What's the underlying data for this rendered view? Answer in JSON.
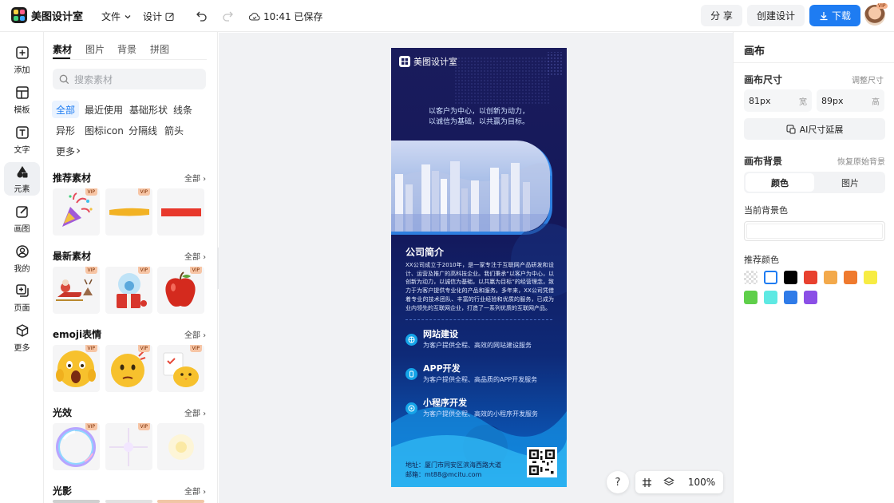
{
  "app": {
    "name": "美图设计室"
  },
  "topbar": {
    "file_menu": "文件",
    "design_menu": "设计",
    "save_status": "10:41 已保存",
    "share_label": "分 享",
    "create_label": "创建设计",
    "download_label": "下载",
    "avatar_badge": "VIP"
  },
  "leftnav": {
    "items": [
      {
        "label": "添加",
        "icon": "plus-square-icon"
      },
      {
        "label": "模板",
        "icon": "template-icon"
      },
      {
        "label": "文字",
        "icon": "text-icon"
      },
      {
        "label": "元素",
        "icon": "shapes-icon"
      },
      {
        "label": "画图",
        "icon": "draw-icon"
      },
      {
        "label": "我的",
        "icon": "user-icon"
      },
      {
        "label": "页面",
        "icon": "page-add-icon"
      },
      {
        "label": "更多",
        "icon": "cube-icon"
      }
    ],
    "active_index": 3
  },
  "panel": {
    "tabs": [
      "素材",
      "图片",
      "背景",
      "拼图"
    ],
    "active_tab": 0,
    "search_placeholder": "搜索素材",
    "chips": [
      "全部",
      "最近使用",
      "基础形状",
      "线条",
      "异形",
      "图标icon",
      "分隔线",
      "箭头",
      "更多"
    ],
    "active_chip": 0,
    "all_label": "全部",
    "vip_label": "VIP",
    "sections": [
      {
        "title": "推荐素材"
      },
      {
        "title": "最新素材"
      },
      {
        "title": "emoji表情"
      },
      {
        "title": "光效"
      },
      {
        "title": "光影"
      }
    ]
  },
  "poster": {
    "brand": "美图设计室",
    "slogan_line1": "以客户为中心，以创新为动力，",
    "slogan_line2": "以诚信为基础，以共赢为目标。",
    "intro_title": "公司简介",
    "intro_text": "XX公司成立于2010年，是一家专注于互联网产品研发和设计、运营及推广的高科技企业。我们秉承“以客户为中心，以创新为动力，以诚信为基础，以共赢为目标”的经营理念，致力于为客户提供专业化的产品和服务。多年来，XX公司凭借着专业的技术团队、丰富的行业经验和优质的服务，已成为业内领先的互联网企业，打造了一系列优质的互联网产品。",
    "services": [
      {
        "title": "网站建设",
        "desc": "为客户提供全程、高效的网站建设服务"
      },
      {
        "title": "APP开发",
        "desc": "为客户提供全程、高品质的APP开发服务"
      },
      {
        "title": "小程序开发",
        "desc": "为客户提供全程、高效的小程序开发服务"
      }
    ],
    "address": "地址：厦门市同安区滨海西路大道",
    "email": "邮箱：mt88@mcitu.com"
  },
  "right": {
    "canvas_title": "画布",
    "size_label": "画布尺寸",
    "adjust_label": "调整尺寸",
    "width_value": "81px",
    "width_unit": "宽",
    "height_value": "89px",
    "height_unit": "高",
    "ai_extend_label": "AI尺寸延展",
    "bg_label": "画布背景",
    "restore_label": "恢复原始背景",
    "bg_tabs": [
      "颜色",
      "图片"
    ],
    "current_bg_label": "当前背景色",
    "recommend_label": "推荐颜色",
    "colors": [
      "transparent",
      "#ffffff",
      "#000000",
      "#e8412f",
      "#f3a94b",
      "#ef7a2e",
      "#f7ec43",
      "#5fcf4a",
      "#5ee9e3",
      "#2f7be8",
      "#8b4fe6"
    ]
  },
  "zoom": {
    "help": "?",
    "level": "100%"
  }
}
